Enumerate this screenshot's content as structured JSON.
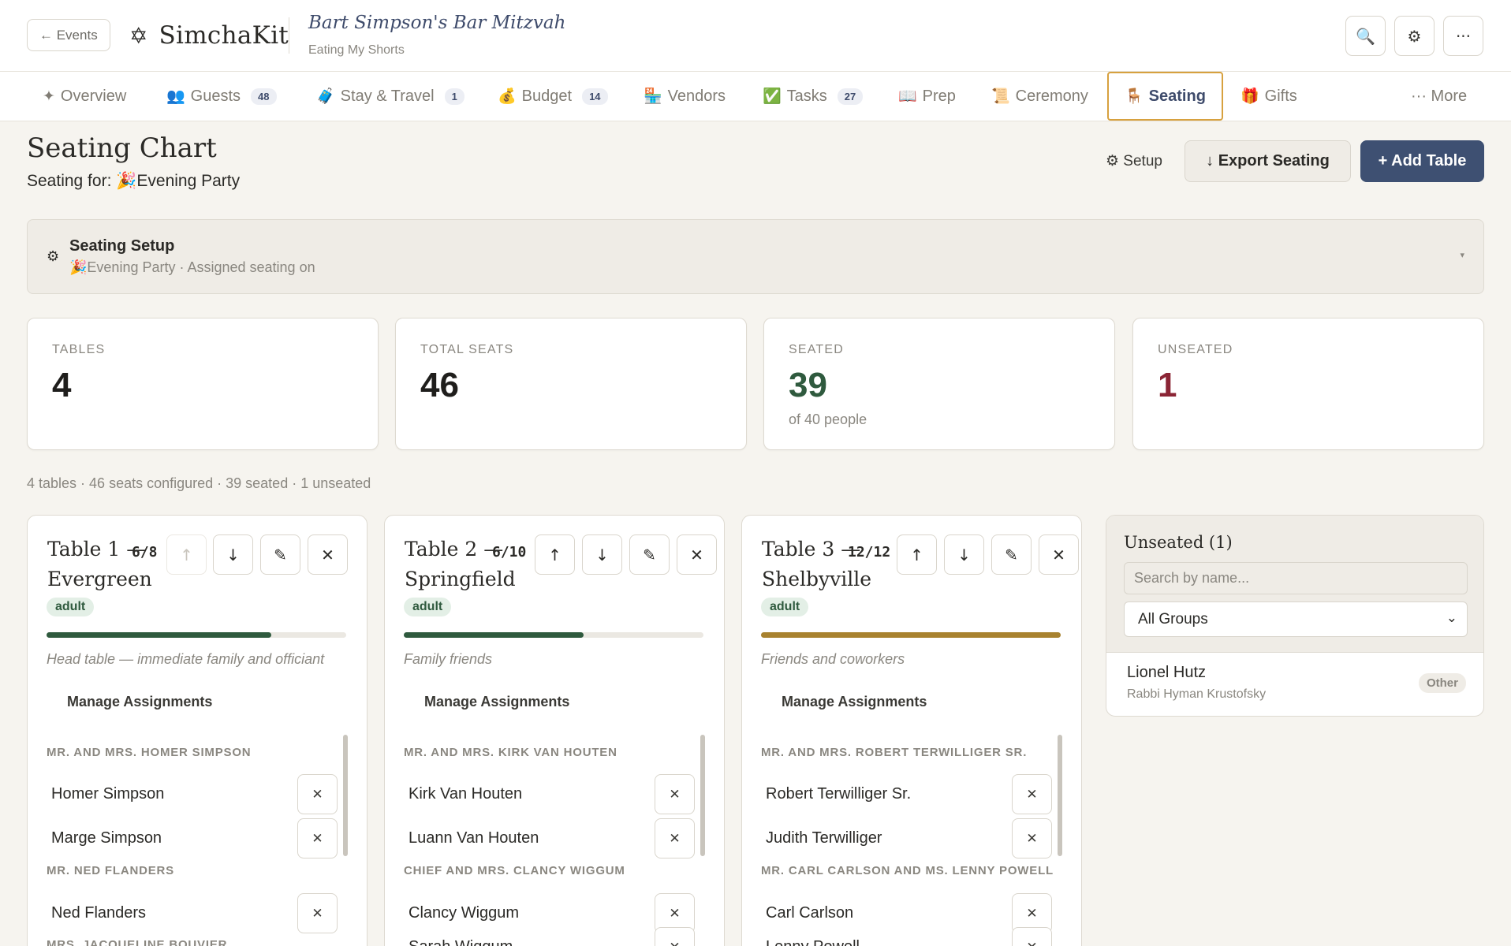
{
  "header": {
    "back_label": "← Events",
    "brand_icon": "✡",
    "brand_name": "SimchaKit",
    "event_title": "Bart Simpson's Bar Mitzvah",
    "event_subtitle": "Eating My Shorts",
    "search_icon": "🔍",
    "settings_icon": "⚙",
    "more_icon": "···"
  },
  "tabs": [
    {
      "icon": "✦",
      "label": "Overview",
      "badge": ""
    },
    {
      "icon": "👥",
      "label": "Guests",
      "badge": "48"
    },
    {
      "icon": "🧳",
      "label": "Stay & Travel",
      "badge": "1"
    },
    {
      "icon": "💰",
      "label": "Budget",
      "badge": "14"
    },
    {
      "icon": "🏪",
      "label": "Vendors",
      "badge": ""
    },
    {
      "icon": "✅",
      "label": "Tasks",
      "badge": "27"
    },
    {
      "icon": "📖",
      "label": "Prep",
      "badge": ""
    },
    {
      "icon": "📜",
      "label": "Ceremony",
      "badge": ""
    },
    {
      "icon": "🪑",
      "label": "Seating",
      "badge": ""
    },
    {
      "icon": "🎁",
      "label": "Gifts",
      "badge": ""
    }
  ],
  "more_tab": "··· More",
  "page": {
    "title": "Seating Chart",
    "subtitle_prefix": "Seating for: ",
    "subtitle_event": "🎉Evening Party",
    "setup_label": "⚙ Setup",
    "export_label": "↓ Export Seating",
    "add_table_label": "+ Add Table"
  },
  "setup_panel": {
    "icon": "⚙",
    "title": "Seating Setup",
    "subtitle": "🎉Evening Party · Assigned seating on",
    "caret": "▾"
  },
  "stats": [
    {
      "label": "TABLES",
      "value": "4",
      "note": "",
      "color": "#1f1e1c"
    },
    {
      "label": "TOTAL SEATS",
      "value": "46",
      "note": "",
      "color": "#1f1e1c"
    },
    {
      "label": "SEATED",
      "value": "39",
      "note": "of 40 people",
      "color": "#2f5a3e"
    },
    {
      "label": "UNSEATED",
      "value": "1",
      "note": "",
      "color": "#8b2535"
    }
  ],
  "summary": "4 tables · 46 seats configured · 39 seated · 1 unseated",
  "tables": [
    {
      "name": "Table 1 — Evergreen",
      "count": "6/8",
      "tag": "adult",
      "fill": 0.75,
      "fill_color": "#2f5a3e",
      "description": "Head table — immediate family and officiant",
      "manage_label": "Manage Assignments",
      "rows": [
        {
          "kind": "group",
          "text": "MR. AND MRS. HOMER SIMPSON"
        },
        {
          "kind": "guest",
          "text": "Homer Simpson"
        },
        {
          "kind": "guest",
          "text": "Marge Simpson"
        },
        {
          "kind": "group",
          "text": "MR. NED FLANDERS"
        },
        {
          "kind": "guest",
          "text": "Ned Flanders"
        },
        {
          "kind": "group",
          "text": "MRS. JACQUELINE BOUVIER"
        }
      ]
    },
    {
      "name": "Table 2 — Springfield",
      "count": "6/10",
      "tag": "adult",
      "fill": 0.6,
      "fill_color": "#2f5a3e",
      "description": "Family friends",
      "manage_label": "Manage Assignments",
      "rows": [
        {
          "kind": "group",
          "text": "MR. AND MRS. KIRK VAN HOUTEN"
        },
        {
          "kind": "guest",
          "text": "Kirk Van Houten"
        },
        {
          "kind": "guest",
          "text": "Luann Van Houten"
        },
        {
          "kind": "group",
          "text": "CHIEF AND MRS. CLANCY WIGGUM"
        },
        {
          "kind": "guest",
          "text": "Clancy Wiggum"
        },
        {
          "kind": "guest",
          "text": "Sarah Wiggum"
        }
      ]
    },
    {
      "name": "Table 3 — Shelbyville",
      "count": "12/12",
      "tag": "adult",
      "fill": 1.0,
      "fill_color": "#a8822f",
      "description": "Friends and coworkers",
      "manage_label": "Manage Assignments",
      "rows": [
        {
          "kind": "group",
          "text": "MR. AND MRS. ROBERT TERWILLIGER SR."
        },
        {
          "kind": "guest",
          "text": "Robert Terwilliger Sr."
        },
        {
          "kind": "guest",
          "text": "Judith Terwilliger"
        },
        {
          "kind": "group",
          "text": "MR. CARL CARLSON AND MS. LENNY POWELL"
        },
        {
          "kind": "guest",
          "text": "Carl Carlson"
        },
        {
          "kind": "guest",
          "text": "Lenny Powell"
        }
      ]
    }
  ],
  "unseated": {
    "title": "Unseated (1)",
    "search_placeholder": "Search by name...",
    "group_filter": "All Groups",
    "people": [
      {
        "name": "Lionel Hutz",
        "info": "Rabbi Hyman Krustofsky",
        "pill": "Other"
      }
    ]
  }
}
